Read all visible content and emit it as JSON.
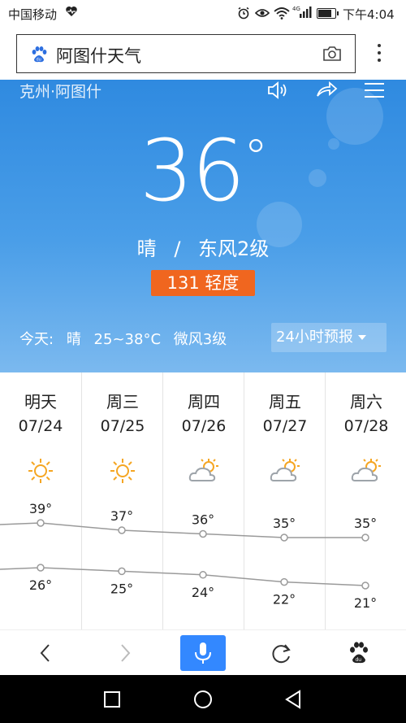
{
  "status_bar": {
    "carrier": "中国移动",
    "time": "下午4:04",
    "battery_level": 0.8,
    "icons": [
      "heart-rate-icon",
      "alarm-icon",
      "eye-icon",
      "wifi-icon",
      "signal-icon",
      "battery-icon"
    ]
  },
  "browser": {
    "search_text": "阿图什天气",
    "icons": [
      "baidu-paw-icon",
      "camera-icon",
      "more-icon"
    ]
  },
  "weather": {
    "location": "克州·阿图什",
    "temperature": "36",
    "degree": "°",
    "condition": "晴",
    "divider": "/",
    "wind": "东风2级",
    "aqi": "131 轻度",
    "today_label": "今天:",
    "today_condition": "晴",
    "today_range": "25~38°C",
    "today_wind": "微风3级",
    "forecast_button": "24小时预报",
    "colors": {
      "sky_top": "#2f8ae0",
      "sky_bottom": "#7bb9ef",
      "aqi_badge": "#f0661f"
    }
  },
  "forecast": {
    "days": [
      {
        "name": "明天",
        "date": "07/24",
        "icon": "sunny",
        "high_label": "39°",
        "low_label": "26°"
      },
      {
        "name": "周三",
        "date": "07/25",
        "icon": "sunny",
        "high_label": "37°",
        "low_label": "25°"
      },
      {
        "name": "周四",
        "date": "07/26",
        "icon": "partly-cloudy",
        "high_label": "36°",
        "low_label": "24°"
      },
      {
        "name": "周五",
        "date": "07/27",
        "icon": "partly-cloudy",
        "high_label": "35°",
        "low_label": "22°"
      },
      {
        "name": "周六",
        "date": "07/28",
        "icon": "partly-cloudy",
        "high_label": "35°",
        "low_label": "21°"
      }
    ]
  },
  "chart_data": {
    "type": "line",
    "categories": [
      "明天",
      "周三",
      "周四",
      "周五",
      "周六"
    ],
    "series": [
      {
        "values": [
          39,
          37,
          36,
          35,
          35
        ]
      },
      {
        "values": [
          26,
          25,
          24,
          22,
          21
        ]
      }
    ],
    "ylabel": "",
    "xlabel": ""
  },
  "bottom_nav": {
    "items": [
      "back-icon",
      "forward-icon",
      "microphone-icon",
      "refresh-icon",
      "baidu-paw-icon"
    ],
    "accent": "#3388ff"
  },
  "system_nav": {
    "items": [
      "recent-apps-icon",
      "home-icon",
      "back-icon"
    ]
  }
}
